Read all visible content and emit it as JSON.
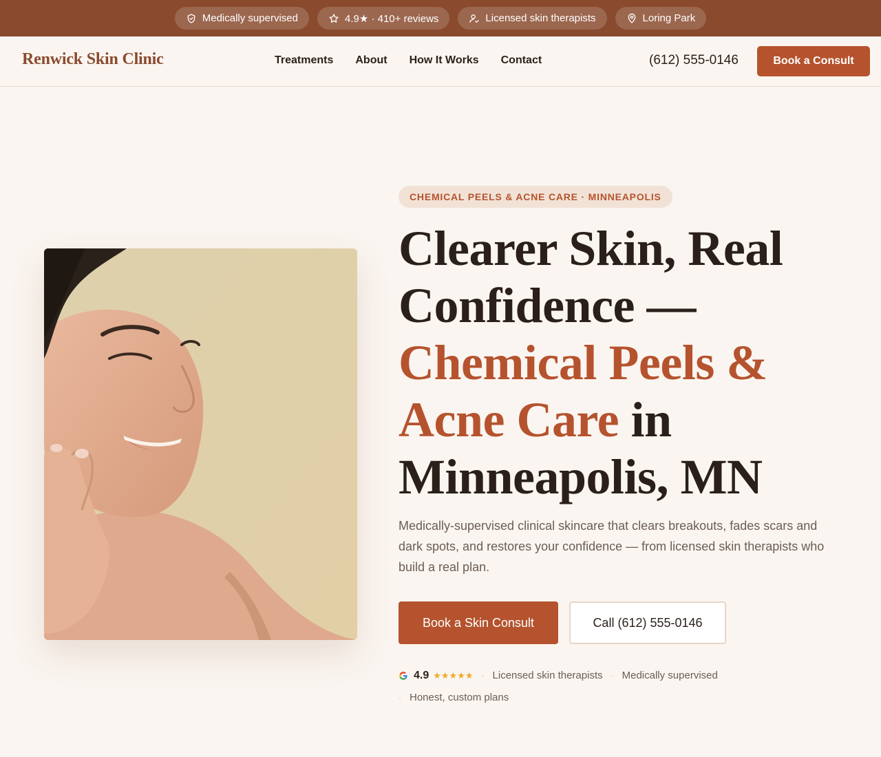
{
  "topbar": {
    "items": [
      {
        "label": "Medically supervised",
        "icon": "shield-icon"
      },
      {
        "label": "4.9★ · 410+ reviews",
        "icon": "star-icon"
      },
      {
        "label": "Licensed skin therapists",
        "icon": "user-check-icon"
      },
      {
        "label": "Loring Park",
        "icon": "map-pin-icon"
      }
    ]
  },
  "header": {
    "logo": "Renwick Skin Clinic",
    "nav": [
      "Treatments",
      "About",
      "How It Works",
      "Contact"
    ],
    "phone": "(612) 555-0146",
    "cta": "Book a Consult"
  },
  "hero": {
    "eyebrow": "CHEMICAL PEELS & ACNE CARE · MINNEAPOLIS",
    "headline": {
      "part1": "Clearer Skin, Real Confidence — ",
      "accent": "Chemical Peels & Acne Care",
      "part2": " in Minneapolis, MN"
    },
    "description": "Medically-supervised clinical skincare that clears breakouts, fades scars and dark spots, and restores your confidence — from licensed skin therapists who build a real plan.",
    "primary_cta": "Book a Skin Consult",
    "secondary_cta": "Call (612) 555-0146",
    "trust": {
      "rating": "4.9",
      "stars": "★★★★★",
      "items": [
        "Licensed skin therapists",
        "Medically supervised",
        "Honest, custom plans"
      ]
    }
  },
  "colors": {
    "brand": "#8a4a2e",
    "accent": "#b5532e",
    "background": "#faf5f0",
    "text": "#2a1f1a",
    "muted": "#6b5d55"
  }
}
